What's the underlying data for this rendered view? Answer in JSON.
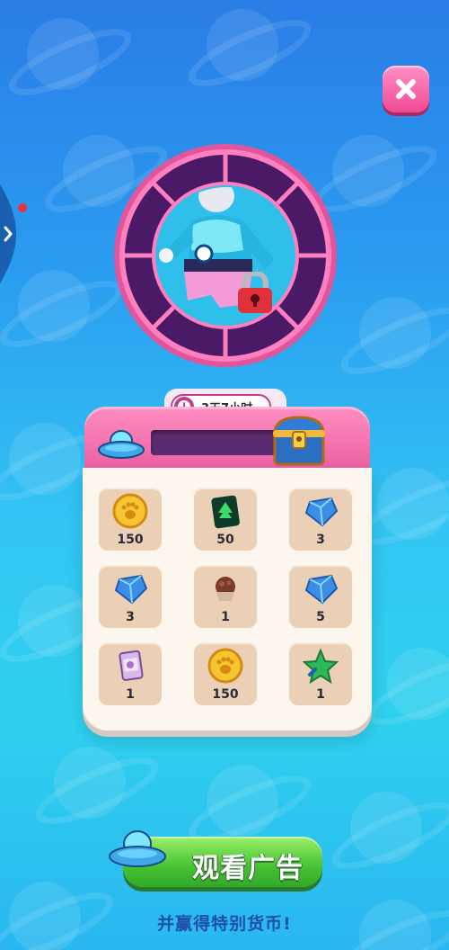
{
  "timer": {
    "text": "3天7小时",
    "icon": "clock-icon"
  },
  "progress": {
    "fraction": 0.0
  },
  "rewards": [
    {
      "name": "coin",
      "icon": "paw-coin-icon",
      "qty": "150"
    },
    {
      "name": "tree-card",
      "icon": "tree-card-icon",
      "qty": "50"
    },
    {
      "name": "gem",
      "icon": "blue-gem-icon",
      "qty": "3"
    },
    {
      "name": "gem",
      "icon": "blue-gem-icon",
      "qty": "3"
    },
    {
      "name": "cupcake",
      "icon": "cupcake-icon",
      "qty": "1"
    },
    {
      "name": "gem",
      "icon": "blue-gem-icon",
      "qty": "5"
    },
    {
      "name": "sticker-pack",
      "icon": "sticker-pack-icon",
      "qty": "1"
    },
    {
      "name": "coin",
      "icon": "paw-coin-icon",
      "qty": "150"
    },
    {
      "name": "star",
      "icon": "green-star-icon",
      "qty": "1"
    }
  ],
  "ad_button": {
    "label": "观看广告"
  },
  "subtitle": "并赢得特别货币!",
  "colors": {
    "accent_pink": "#f06aa8",
    "button_green": "#45c232",
    "panel_cream": "#fdf6ee",
    "slot_tan": "#ecd0b5"
  }
}
